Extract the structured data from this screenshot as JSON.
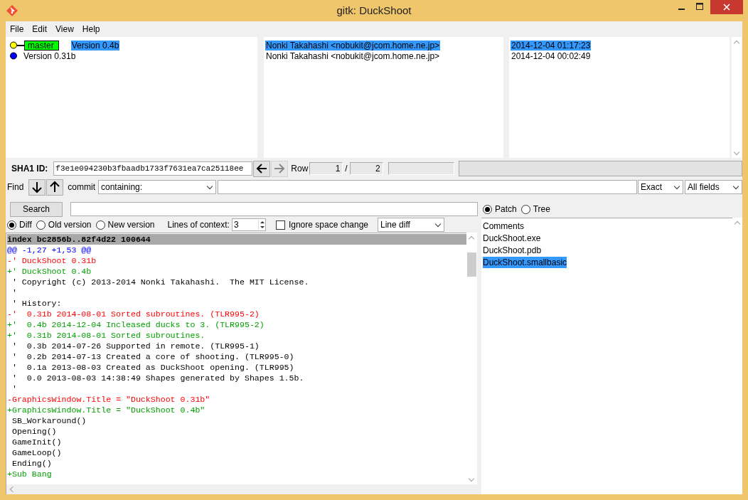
{
  "window": {
    "title": "gitk: DuckShoot"
  },
  "menu": [
    "File",
    "Edit",
    "View",
    "Help"
  ],
  "commits": [
    {
      "color": "#ffff00",
      "branch": "master",
      "message": "Version 0.4b",
      "author": "Nonki Takahashi <nobukit@jcom.home.ne.jp>",
      "date": "2014-12-04 01:17:23",
      "selected": true
    },
    {
      "color": "#0000ff",
      "message": "Version 0.31b",
      "author": "Nonki Takahashi <nobukit@jcom.home.ne.jp>",
      "date": "2014-12-04 00:02:49",
      "selected": false
    }
  ],
  "sha": {
    "label": "SHA1 ID:",
    "value": "f3e1e094230b3fbaadb1733f7631ea7ca25118ee",
    "row_label": "Row",
    "row": "1",
    "separator": "/",
    "total": "2"
  },
  "find": {
    "label": "Find",
    "type": "commit",
    "mode": "containing:",
    "match": "Exact",
    "fields": "All fields"
  },
  "search": {
    "button": "Search"
  },
  "diff_options": {
    "views": [
      {
        "label": "Diff",
        "selected": true
      },
      {
        "label": "Old version",
        "selected": false
      },
      {
        "label": "New version",
        "selected": false
      }
    ],
    "context_label": "Lines of context:",
    "context": "3",
    "ignore_space": {
      "label": "Ignore space change",
      "checked": false
    },
    "diff_mode": "Line diff"
  },
  "diff_lines": [
    {
      "kind": "header",
      "text": "index bc2856b..82f4d22 100644"
    },
    {
      "kind": "hunk",
      "text": "@@ -1,27 +1,53 @@"
    },
    {
      "kind": "del",
      "text": "-' DuckShoot 0.31b"
    },
    {
      "kind": "add",
      "text": "+' DuckShoot 0.4b"
    },
    {
      "kind": "ctx",
      "text": " ' Copyright (c) 2013-2014 Nonki Takahashi.  The MIT License."
    },
    {
      "kind": "ctx",
      "text": " '"
    },
    {
      "kind": "ctx",
      "text": " ' History:"
    },
    {
      "kind": "del",
      "text": "-'  0.31b 2014-08-01 Sorted subroutines. (TLR995-2)"
    },
    {
      "kind": "add",
      "text": "+'  0.4b 2014-12-04 Incleased ducks to 3. (TLR995-2)"
    },
    {
      "kind": "add",
      "text": "+'  0.31b 2014-08-01 Sorted subroutines."
    },
    {
      "kind": "ctx",
      "text": " '  0.3b 2014-07-26 Supported in remote. (TLR995-1)"
    },
    {
      "kind": "ctx",
      "text": " '  0.2b 2014-07-13 Created a core of shooting. (TLR995-0)"
    },
    {
      "kind": "ctx",
      "text": " '  0.1a 2013-08-03 Created as DuckShoot opening. (TLR995)"
    },
    {
      "kind": "ctx",
      "text": " '  0.0 2013-08-03 14:38:49 Shapes generated by Shapes 1.5b."
    },
    {
      "kind": "ctx",
      "text": " '"
    },
    {
      "kind": "del",
      "text": "-GraphicsWindow.Title = \"DuckShoot 0.31b\""
    },
    {
      "kind": "add",
      "text": "+GraphicsWindow.Title = \"DuckShoot 0.4b\""
    },
    {
      "kind": "ctx",
      "text": " SB_Workaround()"
    },
    {
      "kind": "ctx",
      "text": " Opening()"
    },
    {
      "kind": "ctx",
      "text": " GameInit()"
    },
    {
      "kind": "ctx",
      "text": " GameLoop()"
    },
    {
      "kind": "ctx",
      "text": " Ending()"
    },
    {
      "kind": "add",
      "text": "+Sub Bang"
    }
  ],
  "file_view": [
    {
      "label": "Patch",
      "selected": true
    },
    {
      "label": "Tree",
      "selected": false
    }
  ],
  "files": [
    {
      "name": "Comments",
      "selected": false
    },
    {
      "name": "DuckShoot.exe",
      "selected": false
    },
    {
      "name": "DuckShoot.pdb",
      "selected": false
    },
    {
      "name": "DuckShoot.smallbasic",
      "selected": true
    }
  ]
}
